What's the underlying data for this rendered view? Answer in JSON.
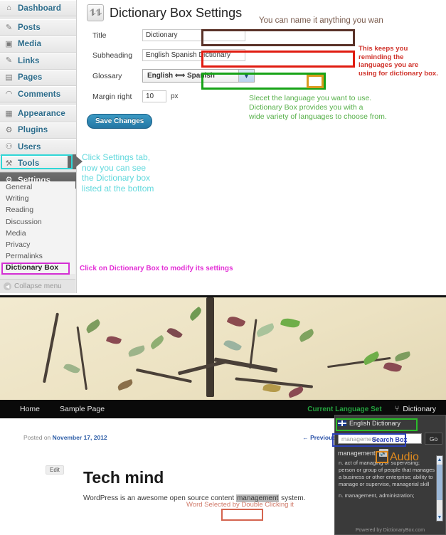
{
  "admin": {
    "sidebar": {
      "items": [
        {
          "label": "Dashboard",
          "icon": "home-icon",
          "glyph": "⌂"
        },
        {
          "label": "Posts",
          "icon": "pin-icon",
          "glyph": "✎"
        },
        {
          "label": "Media",
          "icon": "media-icon",
          "glyph": "▣"
        },
        {
          "label": "Links",
          "icon": "link-icon",
          "glyph": "🔗"
        },
        {
          "label": "Pages",
          "icon": "pages-icon",
          "glyph": "▤"
        },
        {
          "label": "Comments",
          "icon": "comment-icon",
          "glyph": "💬"
        },
        {
          "label": "Appearance",
          "icon": "appearance-icon",
          "glyph": "▦"
        },
        {
          "label": "Plugins",
          "icon": "plugin-icon",
          "glyph": "⚙"
        },
        {
          "label": "Users",
          "icon": "users-icon",
          "glyph": "👤"
        },
        {
          "label": "Tools",
          "icon": "tools-icon",
          "glyph": "⚒"
        },
        {
          "label": "Settings",
          "icon": "settings-icon",
          "glyph": "⚙"
        }
      ],
      "submenu": [
        "General",
        "Writing",
        "Reading",
        "Discussion",
        "Media",
        "Privacy",
        "Permalinks",
        "Dictionary Box"
      ],
      "collapse_label": "Collapse menu"
    },
    "page_title": "Dictionary Box Settings",
    "fields": {
      "title_label": "Title",
      "title_value": "Dictionary",
      "subheading_label": "Subheading",
      "subheading_value": "English Spanish Dictionary",
      "glossary_label": "Glossary",
      "glossary_value": "English ⟺ Spanish",
      "margin_label": "Margin right",
      "margin_value": "10",
      "margin_unit": "px"
    },
    "save_label": "Save Changes"
  },
  "annotations": {
    "title_note": "You can name it anything you wan",
    "sub_note": "This keeps you\nreminding the\nlanguages you are\nusing for dictionary box.",
    "glossary_note": "Slecet the language you want to use.\nDictionary Box provides you with a\nwide variety of languages to choose from.",
    "settings_note": "Click Settings tab,\nnow you can see\nthe Dictionary box\nlisted at the bottom",
    "dictbox_note": "Click on Dictionary Box to modify its settings",
    "search_box_note": "Search Box",
    "audio_note": "Audio",
    "selected_word_note": "Word Selected by Double Clicking it"
  },
  "colors": {
    "title_ring": "#5a3228",
    "sub_ring": "#e01b10",
    "glossary_ring": "#17a317",
    "arrow_ring": "#d99a1e",
    "settings_ring": "#2fd6d6",
    "dictbox_ring": "#d42fd4",
    "dict_title_ring": "#2bbd2b",
    "search_ring": "#2b3fb5",
    "audio_ring": "#e08a1e",
    "word_ring": "#d4644f"
  },
  "site": {
    "nav": {
      "home": "Home",
      "sample_page": "Sample Page",
      "language_set": "Current Language Set",
      "dictionary": "Dictionary"
    },
    "post": {
      "posted_prefix": "Posted on ",
      "posted_date": "November 17, 2012",
      "previous": "← Previous",
      "edit": "Edit",
      "title": "Tech mind",
      "body_before": "WordPress is an awesome open source content ",
      "body_selected": "management",
      "body_after": " system."
    },
    "dictionary_panel": {
      "title": "English Dictionary",
      "search_value": "management",
      "go_label": "Go",
      "word": "management",
      "definitions": [
        "n. act of managing or supervising; person or group of people that manages a business or other enterprise; ability to manage or supervise, managerial skill",
        "n. management, administration;"
      ],
      "footer": "Powered by DictionaryBox.com"
    }
  }
}
